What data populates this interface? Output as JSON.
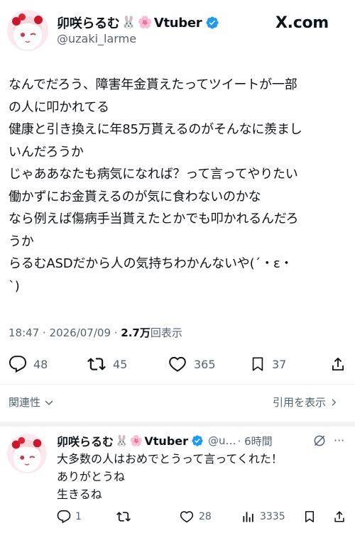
{
  "header": {
    "display_name": "卯咲らるむ",
    "emoji_rabbit": "🐰",
    "emoji_flower": "🌸",
    "name_suffix": "Vtuber",
    "handle": "@uzaki_larme",
    "source_site": "X.com"
  },
  "tweet": {
    "lines": [
      "なんでだろう、障害年金貰えたってツイートが一部",
      "の人に叩かれてる",
      "健康と引き換えに年85万貰えるのがそんなに羨まし",
      "いんだろうか",
      "じゃああなたも病気になれば？って言ってやりたい",
      "働かずにお金貰えるのが気に食わないのかな",
      "なら例えば傷病手当貰えたとかでも叩かれるんだろ",
      "うか",
      "らるむASDだから人の気持ちわかんないや(´・ε・",
      "`)"
    ],
    "timestamp": "18:47 · 2026/07/09 · ",
    "views": "2.7万",
    "views_label": "回表示",
    "stats": {
      "replies": "48",
      "retweets": "45",
      "likes": "365",
      "bookmarks": "37"
    }
  },
  "related_label": "関連性",
  "quote_label": "引用を表示",
  "reply": {
    "display_name": "卯咲らるむ",
    "emoji_rabbit": "🐰",
    "emoji_flower": "🌸",
    "name_suffix": "Vtuber",
    "handle": "@u…",
    "time": "· 6時間",
    "lines": [
      "大多数の人はおめでとうって言ってくれた！",
      "ありがとうね",
      "生きるね"
    ],
    "stats": {
      "replies": "1",
      "likes": "28",
      "views": "3335"
    }
  },
  "colors": {
    "verified": "#1d9bf0",
    "text": "#0f1419",
    "secondary": "#536471",
    "divider": "#eff3f4"
  }
}
